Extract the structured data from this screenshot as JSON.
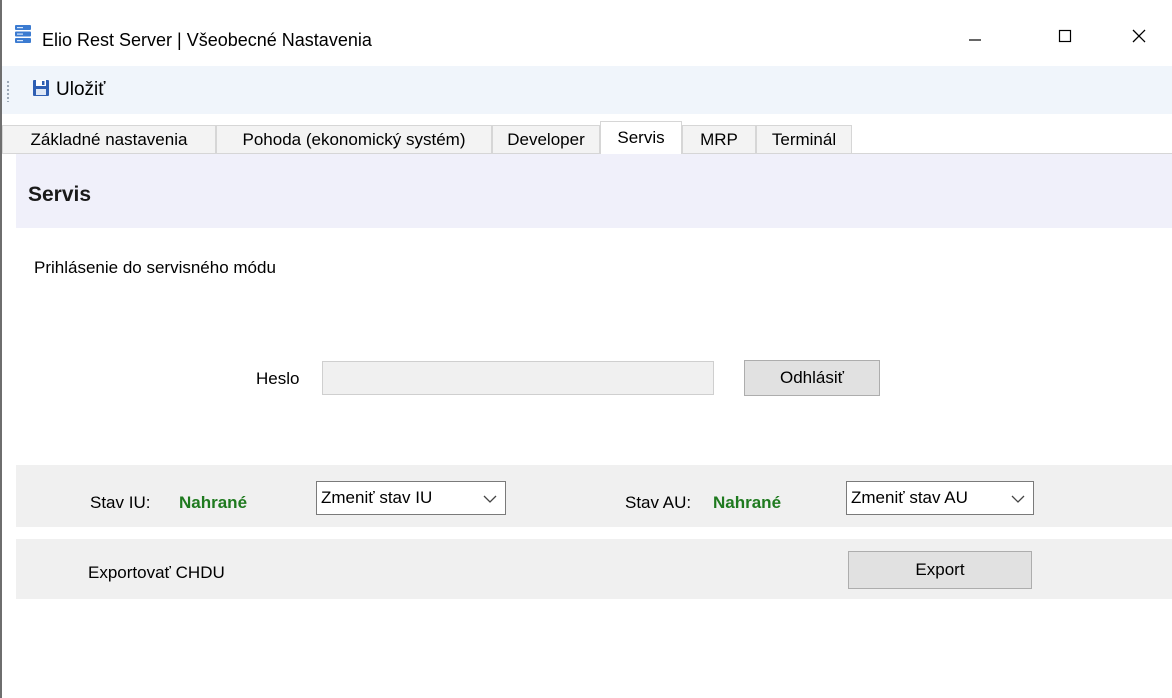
{
  "window": {
    "title": "Elio Rest Server | Všeobecné Nastavenia",
    "icon": "server-stack-icon"
  },
  "toolbar": {
    "save_label": "Uložiť",
    "save_icon": "floppy-disk-icon"
  },
  "tabs": [
    {
      "label": "Základné nastavenia",
      "active": false
    },
    {
      "label": "Pohoda (ekonomický systém)",
      "active": false
    },
    {
      "label": "Developer",
      "active": false
    },
    {
      "label": "Servis",
      "active": true
    },
    {
      "label": "MRP",
      "active": false
    },
    {
      "label": "Terminál",
      "active": false
    }
  ],
  "section": {
    "title": "Servis",
    "login_label": "Prihlásenie do servisného módu"
  },
  "login": {
    "password_label": "Heslo",
    "password_value": "",
    "logout_label": "Odhlásiť"
  },
  "states": {
    "iu_label": "Stav IU:",
    "iu_value": "Nahrané",
    "iu_select": "Zmeniť stav IU",
    "au_label": "Stav AU:",
    "au_value": "Nahrané",
    "au_select": "Zmeniť stav AU"
  },
  "export": {
    "label": "Exportovať CHDU",
    "button": "Export"
  },
  "colors": {
    "status_ok": "#1f7a1f",
    "section_header_bg": "#f0f0fa",
    "toolbar_bg": "#f0f5fb"
  }
}
